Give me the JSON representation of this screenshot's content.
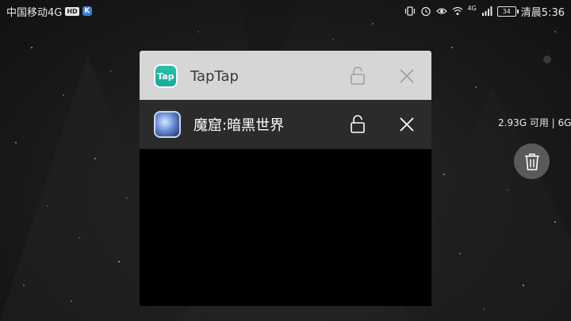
{
  "status_bar": {
    "carrier": "中国移动4G",
    "hd_badge": "HD",
    "k_badge": "K",
    "network": "4G",
    "battery": "34",
    "time": "清晨5:36"
  },
  "recent_apps": [
    {
      "name": "TapTap",
      "icon": "taptap-icon",
      "icon_text": "Tap"
    },
    {
      "name": "魔窟:暗黑世界",
      "icon": "game-icon"
    }
  ],
  "memory": {
    "text": "2.93G 可用 | 6G"
  },
  "colors": {
    "taptap_header": "#d6d6d6",
    "active_header": "#2b2b2b",
    "trash_button": "#5a5a5a"
  }
}
